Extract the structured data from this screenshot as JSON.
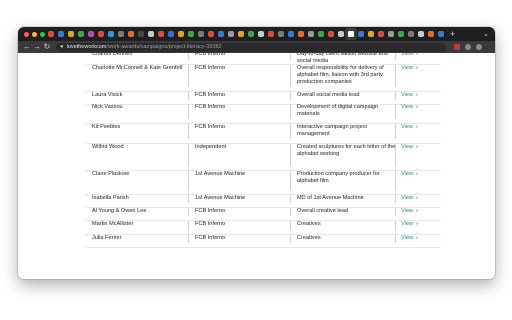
{
  "browser": {
    "url_host": "lovetheworkcom",
    "url_path": "/work-awards/campaigns/project-literacy-39382",
    "new_tab_label": "+",
    "tab_menu_label": "⌄",
    "nav": {
      "back": "←",
      "forward": "→",
      "reload": "↻"
    },
    "tab_favicon_colors": [
      "#d64b3c",
      "#3a78c9",
      "#e0a02c",
      "#3fa34d",
      "#b84bb0",
      "#d64b3c",
      "#2b9ad6",
      "#7a7a7a",
      "#e36b2f",
      "#4a4a4a",
      "#c7c7c7",
      "#d64b3c",
      "#2f6fd0",
      "#e0a02c",
      "#3fa34d",
      "#7a7a7a",
      "#d64b3c",
      "#3a78c9",
      "#9a9a9a",
      "#e0a02c",
      "#3fa34d",
      "#c7c7c7",
      "#d64b3c",
      "#7a7a7a",
      "#3a78c9",
      "#e36b2f",
      "#9a9a9a",
      "#3fa34d",
      "#d64b3c",
      "#c7c7c7",
      "#7a7a7a",
      "#3a78c9",
      "#e0a02c",
      "#d64b3c",
      "#9a9a9a",
      "#3fa34d",
      "#7a7a7a",
      "#c7c7c7",
      "#e36b2f",
      "#3a78c9"
    ],
    "active_tab_index": 30
  },
  "table": {
    "view_label": "View",
    "view_chevron": "›",
    "rows": [
      {
        "name": "Charles Dennen",
        "company": "FCB Inferno",
        "role": "Day-to-day client liaison website and social media"
      },
      {
        "name": "Charlotte McConnell & Kate Grenfell",
        "company": "FCB Inferno",
        "role": "Overall responsibility for delivery of alphabet film, liaison with 3rd party production companies"
      },
      {
        "name": "Laura Visick",
        "company": "FCB Inferno",
        "role": "Overall social media lead"
      },
      {
        "name": "Nick Vassou",
        "company": "FCB Inferno",
        "role": "Development of digital campaign materials"
      },
      {
        "name": "Kit Peebles",
        "company": "FCB Inferno",
        "role": "Interactive campaign project management"
      },
      {
        "name": "Wilfrid Wood",
        "company": "Independent",
        "role": "Created sculptures for each letter of the alphabet working"
      },
      {
        "name": "Claire Plaskow",
        "company": "1st Avenue Machine",
        "role": "Production company producer for alphabet film"
      },
      {
        "name": "Isabella Parish",
        "company": "1st Avenue Machine",
        "role": "MD of 1st Avenue Machine"
      },
      {
        "name": "Al Young & Owen Lee",
        "company": "FCB Inferno",
        "role": "Overall creative lead"
      },
      {
        "name": "Martin McAllister",
        "company": "FCB Inferno",
        "role": "Creatives"
      },
      {
        "name": "Julia Ferrier",
        "company": "FCB Inferno",
        "role": "Creatives"
      }
    ]
  }
}
